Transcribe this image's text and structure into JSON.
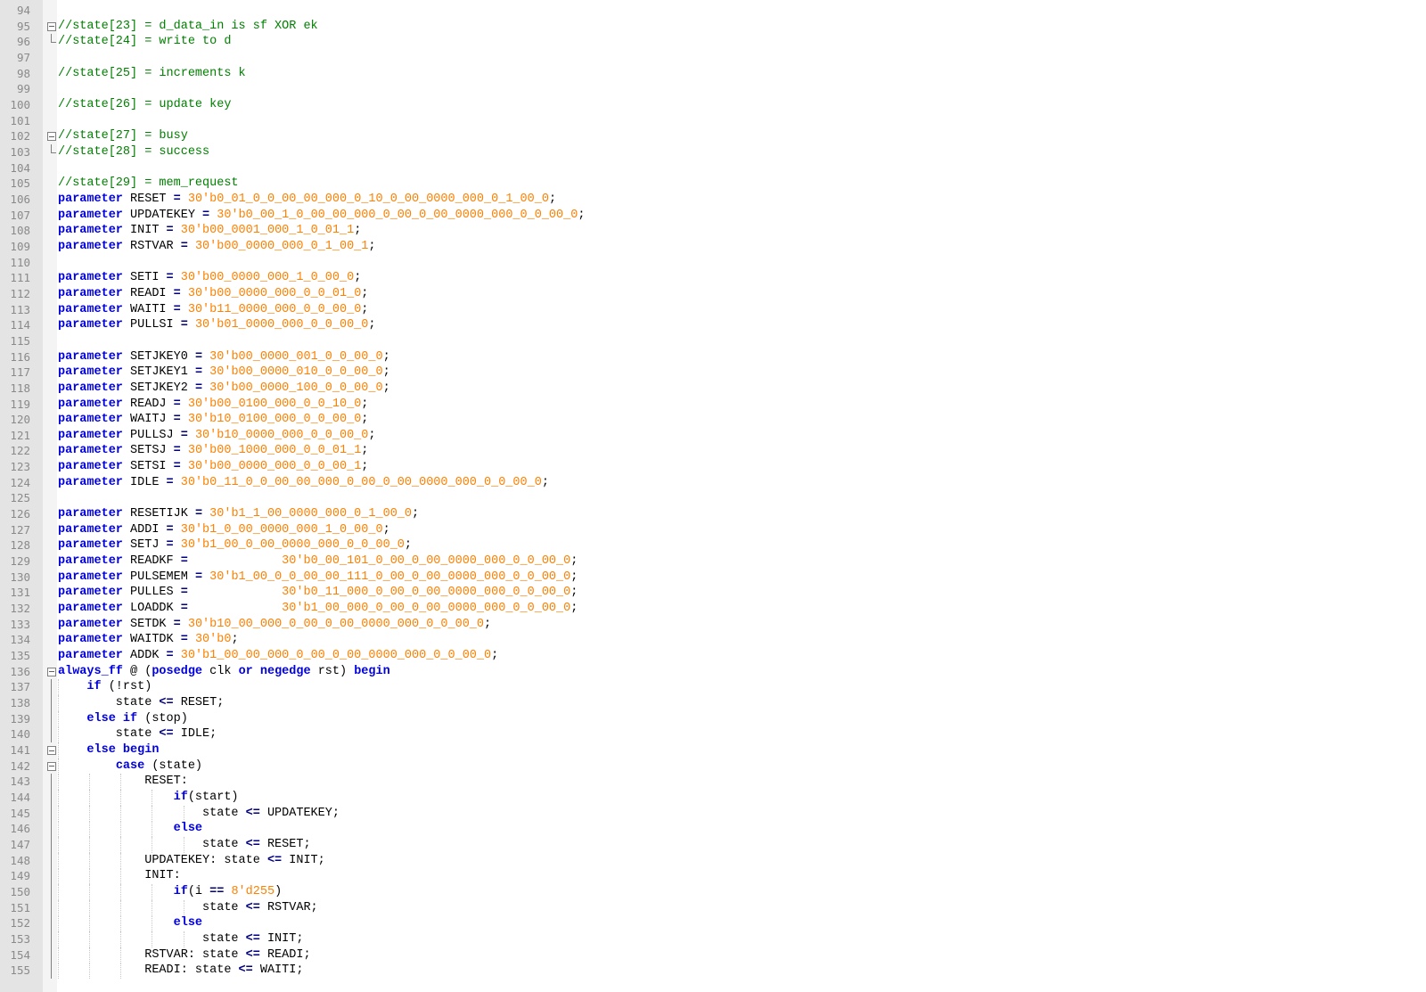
{
  "editor": {
    "lines": [
      {
        "n": "94",
        "t": []
      },
      {
        "n": "95",
        "fold": "start",
        "t": [
          {
            "c": "cm",
            "s": "//state[23] = d_data_in is sf XOR ek"
          }
        ]
      },
      {
        "n": "96",
        "fold": "end",
        "t": [
          {
            "c": "cm",
            "s": "//state[24] = write to d"
          }
        ]
      },
      {
        "n": "97",
        "t": []
      },
      {
        "n": "98",
        "t": [
          {
            "c": "cm",
            "s": "//state[25] = increments k"
          }
        ]
      },
      {
        "n": "99",
        "t": []
      },
      {
        "n": "100",
        "t": [
          {
            "c": "cm",
            "s": "//state[26] = update key"
          }
        ]
      },
      {
        "n": "101",
        "t": []
      },
      {
        "n": "102",
        "fold": "start",
        "t": [
          {
            "c": "cm",
            "s": "//state[27] = busy"
          }
        ]
      },
      {
        "n": "103",
        "fold": "end",
        "t": [
          {
            "c": "cm",
            "s": "//state[28] = success"
          }
        ]
      },
      {
        "n": "104",
        "t": []
      },
      {
        "n": "105",
        "t": [
          {
            "c": "cm",
            "s": "//state[29] = mem_request"
          }
        ]
      },
      {
        "n": "106",
        "t": [
          {
            "c": "kw",
            "s": "parameter"
          },
          {
            "s": " RESET "
          },
          {
            "c": "op",
            "s": "="
          },
          {
            "s": " "
          },
          {
            "c": "num",
            "s": "30'b0_01_0_0_00_00_000_0_10_0_00_0000_000_0_1_00_0"
          },
          {
            "s": ";"
          }
        ]
      },
      {
        "n": "107",
        "t": [
          {
            "c": "kw",
            "s": "parameter"
          },
          {
            "s": " UPDATEKEY "
          },
          {
            "c": "op",
            "s": "="
          },
          {
            "s": " "
          },
          {
            "c": "num",
            "s": "30'b0_00_1_0_00_00_000_0_00_0_00_0000_000_0_0_00_0"
          },
          {
            "s": ";"
          }
        ]
      },
      {
        "n": "108",
        "t": [
          {
            "c": "kw",
            "s": "parameter"
          },
          {
            "s": " INIT "
          },
          {
            "c": "op",
            "s": "="
          },
          {
            "s": " "
          },
          {
            "c": "num",
            "s": "30'b00_0001_000_1_0_01_1"
          },
          {
            "s": ";"
          }
        ]
      },
      {
        "n": "109",
        "t": [
          {
            "c": "kw",
            "s": "parameter"
          },
          {
            "s": " RSTVAR "
          },
          {
            "c": "op",
            "s": "="
          },
          {
            "s": " "
          },
          {
            "c": "num",
            "s": "30'b00_0000_000_0_1_00_1"
          },
          {
            "s": ";"
          }
        ]
      },
      {
        "n": "110",
        "t": []
      },
      {
        "n": "111",
        "t": [
          {
            "c": "kw",
            "s": "parameter"
          },
          {
            "s": " SETI "
          },
          {
            "c": "op",
            "s": "="
          },
          {
            "s": " "
          },
          {
            "c": "num",
            "s": "30'b00_0000_000_1_0_00_0"
          },
          {
            "s": ";"
          }
        ]
      },
      {
        "n": "112",
        "t": [
          {
            "c": "kw",
            "s": "parameter"
          },
          {
            "s": " READI "
          },
          {
            "c": "op",
            "s": "="
          },
          {
            "s": " "
          },
          {
            "c": "num",
            "s": "30'b00_0000_000_0_0_01_0"
          },
          {
            "s": ";"
          }
        ]
      },
      {
        "n": "113",
        "t": [
          {
            "c": "kw",
            "s": "parameter"
          },
          {
            "s": " WAITI "
          },
          {
            "c": "op",
            "s": "="
          },
          {
            "s": " "
          },
          {
            "c": "num",
            "s": "30'b11_0000_000_0_0_00_0"
          },
          {
            "s": ";"
          }
        ]
      },
      {
        "n": "114",
        "t": [
          {
            "c": "kw",
            "s": "parameter"
          },
          {
            "s": " PULLSI "
          },
          {
            "c": "op",
            "s": "="
          },
          {
            "s": " "
          },
          {
            "c": "num",
            "s": "30'b01_0000_000_0_0_00_0"
          },
          {
            "s": ";"
          }
        ]
      },
      {
        "n": "115",
        "t": []
      },
      {
        "n": "116",
        "t": [
          {
            "c": "kw",
            "s": "parameter"
          },
          {
            "s": " SETJKEY0 "
          },
          {
            "c": "op",
            "s": "="
          },
          {
            "s": " "
          },
          {
            "c": "num",
            "s": "30'b00_0000_001_0_0_00_0"
          },
          {
            "s": ";"
          }
        ]
      },
      {
        "n": "117",
        "t": [
          {
            "c": "kw",
            "s": "parameter"
          },
          {
            "s": " SETJKEY1 "
          },
          {
            "c": "op",
            "s": "="
          },
          {
            "s": " "
          },
          {
            "c": "num",
            "s": "30'b00_0000_010_0_0_00_0"
          },
          {
            "s": ";"
          }
        ]
      },
      {
        "n": "118",
        "t": [
          {
            "c": "kw",
            "s": "parameter"
          },
          {
            "s": " SETJKEY2 "
          },
          {
            "c": "op",
            "s": "="
          },
          {
            "s": " "
          },
          {
            "c": "num",
            "s": "30'b00_0000_100_0_0_00_0"
          },
          {
            "s": ";"
          }
        ]
      },
      {
        "n": "119",
        "t": [
          {
            "c": "kw",
            "s": "parameter"
          },
          {
            "s": " READJ "
          },
          {
            "c": "op",
            "s": "="
          },
          {
            "s": " "
          },
          {
            "c": "num",
            "s": "30'b00_0100_000_0_0_10_0"
          },
          {
            "s": ";"
          }
        ]
      },
      {
        "n": "120",
        "t": [
          {
            "c": "kw",
            "s": "parameter"
          },
          {
            "s": " WAITJ "
          },
          {
            "c": "op",
            "s": "="
          },
          {
            "s": " "
          },
          {
            "c": "num",
            "s": "30'b10_0100_000_0_0_00_0"
          },
          {
            "s": ";"
          }
        ]
      },
      {
        "n": "121",
        "t": [
          {
            "c": "kw",
            "s": "parameter"
          },
          {
            "s": " PULLSJ "
          },
          {
            "c": "op",
            "s": "="
          },
          {
            "s": " "
          },
          {
            "c": "num",
            "s": "30'b10_0000_000_0_0_00_0"
          },
          {
            "s": ";"
          }
        ]
      },
      {
        "n": "122",
        "t": [
          {
            "c": "kw",
            "s": "parameter"
          },
          {
            "s": " SETSJ "
          },
          {
            "c": "op",
            "s": "="
          },
          {
            "s": " "
          },
          {
            "c": "num",
            "s": "30'b00_1000_000_0_0_01_1"
          },
          {
            "s": ";"
          }
        ]
      },
      {
        "n": "123",
        "t": [
          {
            "c": "kw",
            "s": "parameter"
          },
          {
            "s": " SETSI "
          },
          {
            "c": "op",
            "s": "="
          },
          {
            "s": " "
          },
          {
            "c": "num",
            "s": "30'b00_0000_000_0_0_00_1"
          },
          {
            "s": ";"
          }
        ]
      },
      {
        "n": "124",
        "t": [
          {
            "c": "kw",
            "s": "parameter"
          },
          {
            "s": " IDLE "
          },
          {
            "c": "op",
            "s": "="
          },
          {
            "s": " "
          },
          {
            "c": "num",
            "s": "30'b0_11_0_0_00_00_000_0_00_0_00_0000_000_0_0_00_0"
          },
          {
            "s": ";"
          }
        ]
      },
      {
        "n": "125",
        "t": []
      },
      {
        "n": "126",
        "t": [
          {
            "c": "kw",
            "s": "parameter"
          },
          {
            "s": " RESETIJK "
          },
          {
            "c": "op",
            "s": "="
          },
          {
            "s": " "
          },
          {
            "c": "num",
            "s": "30'b1_1_00_0000_000_0_1_00_0"
          },
          {
            "s": ";"
          }
        ]
      },
      {
        "n": "127",
        "t": [
          {
            "c": "kw",
            "s": "parameter"
          },
          {
            "s": " ADDI "
          },
          {
            "c": "op",
            "s": "="
          },
          {
            "s": " "
          },
          {
            "c": "num",
            "s": "30'b1_0_00_0000_000_1_0_00_0"
          },
          {
            "s": ";"
          }
        ]
      },
      {
        "n": "128",
        "t": [
          {
            "c": "kw",
            "s": "parameter"
          },
          {
            "s": " SETJ "
          },
          {
            "c": "op",
            "s": "="
          },
          {
            "s": " "
          },
          {
            "c": "num",
            "s": "30'b1_00_0_00_0000_000_0_0_00_0"
          },
          {
            "s": ";"
          }
        ]
      },
      {
        "n": "129",
        "t": [
          {
            "c": "kw",
            "s": "parameter"
          },
          {
            "s": " READKF "
          },
          {
            "c": "op",
            "s": "="
          },
          {
            "s": "             "
          },
          {
            "c": "num",
            "s": "30'b0_00_101_0_00_0_00_0000_000_0_0_00_0"
          },
          {
            "s": ";"
          }
        ]
      },
      {
        "n": "130",
        "t": [
          {
            "c": "kw",
            "s": "parameter"
          },
          {
            "s": " PULSEMEM "
          },
          {
            "c": "op",
            "s": "="
          },
          {
            "s": " "
          },
          {
            "c": "num",
            "s": "30'b1_00_0_0_00_00_111_0_00_0_00_0000_000_0_0_00_0"
          },
          {
            "s": ";"
          }
        ]
      },
      {
        "n": "131",
        "t": [
          {
            "c": "kw",
            "s": "parameter"
          },
          {
            "s": " PULLES "
          },
          {
            "c": "op",
            "s": "="
          },
          {
            "s": "             "
          },
          {
            "c": "num",
            "s": "30'b0_11_000_0_00_0_00_0000_000_0_0_00_0"
          },
          {
            "s": ";"
          }
        ]
      },
      {
        "n": "132",
        "t": [
          {
            "c": "kw",
            "s": "parameter"
          },
          {
            "s": " LOADDK "
          },
          {
            "c": "op",
            "s": "="
          },
          {
            "s": "             "
          },
          {
            "c": "num",
            "s": "30'b1_00_000_0_00_0_00_0000_000_0_0_00_0"
          },
          {
            "s": ";"
          }
        ]
      },
      {
        "n": "133",
        "t": [
          {
            "c": "kw",
            "s": "parameter"
          },
          {
            "s": " SETDK "
          },
          {
            "c": "op",
            "s": "="
          },
          {
            "s": " "
          },
          {
            "c": "num",
            "s": "30'b10_00_000_0_00_0_00_0000_000_0_0_00_0"
          },
          {
            "s": ";"
          }
        ]
      },
      {
        "n": "134",
        "t": [
          {
            "c": "kw",
            "s": "parameter"
          },
          {
            "s": " WAITDK "
          },
          {
            "c": "op",
            "s": "="
          },
          {
            "s": " "
          },
          {
            "c": "num",
            "s": "30'b0"
          },
          {
            "s": ";"
          }
        ]
      },
      {
        "n": "135",
        "t": [
          {
            "c": "kw",
            "s": "parameter"
          },
          {
            "s": " ADDK "
          },
          {
            "c": "op",
            "s": "="
          },
          {
            "s": " "
          },
          {
            "c": "num",
            "s": "30'b1_00_00_000_0_00_0_00_0000_000_0_0_00_0"
          },
          {
            "s": ";"
          }
        ]
      },
      {
        "n": "136",
        "fold": "start",
        "t": [
          {
            "c": "kw",
            "s": "always_ff"
          },
          {
            "s": " @ ("
          },
          {
            "c": "kw",
            "s": "posedge"
          },
          {
            "s": " clk "
          },
          {
            "c": "kw",
            "s": "or"
          },
          {
            "s": " "
          },
          {
            "c": "kw",
            "s": "negedge"
          },
          {
            "s": " rst) "
          },
          {
            "c": "kw",
            "s": "begin"
          }
        ]
      },
      {
        "n": "137",
        "fold": "line",
        "t": [
          {
            "s": "    "
          },
          {
            "c": "kw",
            "s": "if"
          },
          {
            "s": " (!rst)"
          }
        ]
      },
      {
        "n": "138",
        "fold": "line",
        "t": [
          {
            "s": "        state "
          },
          {
            "c": "op",
            "s": "<="
          },
          {
            "s": " RESET;"
          }
        ]
      },
      {
        "n": "139",
        "fold": "line",
        "t": [
          {
            "s": "    "
          },
          {
            "c": "kw",
            "s": "else if"
          },
          {
            "s": " (stop)"
          }
        ]
      },
      {
        "n": "140",
        "fold": "line",
        "t": [
          {
            "s": "        state "
          },
          {
            "c": "op",
            "s": "<="
          },
          {
            "s": " IDLE;"
          }
        ]
      },
      {
        "n": "141",
        "fold": "start",
        "t": [
          {
            "s": "    "
          },
          {
            "c": "kw",
            "s": "else begin"
          }
        ]
      },
      {
        "n": "142",
        "fold": "start",
        "t": [
          {
            "s": "        "
          },
          {
            "c": "kw",
            "s": "case"
          },
          {
            "s": " (state)"
          }
        ]
      },
      {
        "n": "143",
        "fold": "line",
        "t": [
          {
            "s": "            RESET:"
          }
        ]
      },
      {
        "n": "144",
        "fold": "line",
        "t": [
          {
            "s": "                "
          },
          {
            "c": "kw",
            "s": "if"
          },
          {
            "s": "(start)"
          }
        ]
      },
      {
        "n": "145",
        "fold": "line",
        "t": [
          {
            "s": "                    state "
          },
          {
            "c": "op",
            "s": "<="
          },
          {
            "s": " UPDATEKEY;"
          }
        ]
      },
      {
        "n": "146",
        "fold": "line",
        "t": [
          {
            "s": "                "
          },
          {
            "c": "kw",
            "s": "else"
          }
        ]
      },
      {
        "n": "147",
        "fold": "line",
        "t": [
          {
            "s": "                    state "
          },
          {
            "c": "op",
            "s": "<="
          },
          {
            "s": " RESET;"
          }
        ]
      },
      {
        "n": "148",
        "fold": "line",
        "t": [
          {
            "s": "            UPDATEKEY: state "
          },
          {
            "c": "op",
            "s": "<="
          },
          {
            "s": " INIT;"
          }
        ]
      },
      {
        "n": "149",
        "fold": "line",
        "t": [
          {
            "s": "            INIT:"
          }
        ]
      },
      {
        "n": "150",
        "fold": "line",
        "t": [
          {
            "s": "                "
          },
          {
            "c": "kw",
            "s": "if"
          },
          {
            "s": "(i "
          },
          {
            "c": "op",
            "s": "=="
          },
          {
            "s": " "
          },
          {
            "c": "num",
            "s": "8'd255"
          },
          {
            "s": ")"
          }
        ]
      },
      {
        "n": "151",
        "fold": "line",
        "t": [
          {
            "s": "                    state "
          },
          {
            "c": "op",
            "s": "<="
          },
          {
            "s": " RSTVAR;"
          }
        ]
      },
      {
        "n": "152",
        "fold": "line",
        "t": [
          {
            "s": "                "
          },
          {
            "c": "kw",
            "s": "else"
          }
        ]
      },
      {
        "n": "153",
        "fold": "line",
        "t": [
          {
            "s": "                    state "
          },
          {
            "c": "op",
            "s": "<="
          },
          {
            "s": " INIT;"
          }
        ]
      },
      {
        "n": "154",
        "fold": "line",
        "t": [
          {
            "s": "            RSTVAR: state "
          },
          {
            "c": "op",
            "s": "<="
          },
          {
            "s": " READI;"
          }
        ]
      },
      {
        "n": "155",
        "fold": "line",
        "t": [
          {
            "s": "            READI: state "
          },
          {
            "c": "op",
            "s": "<="
          },
          {
            "s": " WAITI;"
          }
        ]
      }
    ]
  }
}
